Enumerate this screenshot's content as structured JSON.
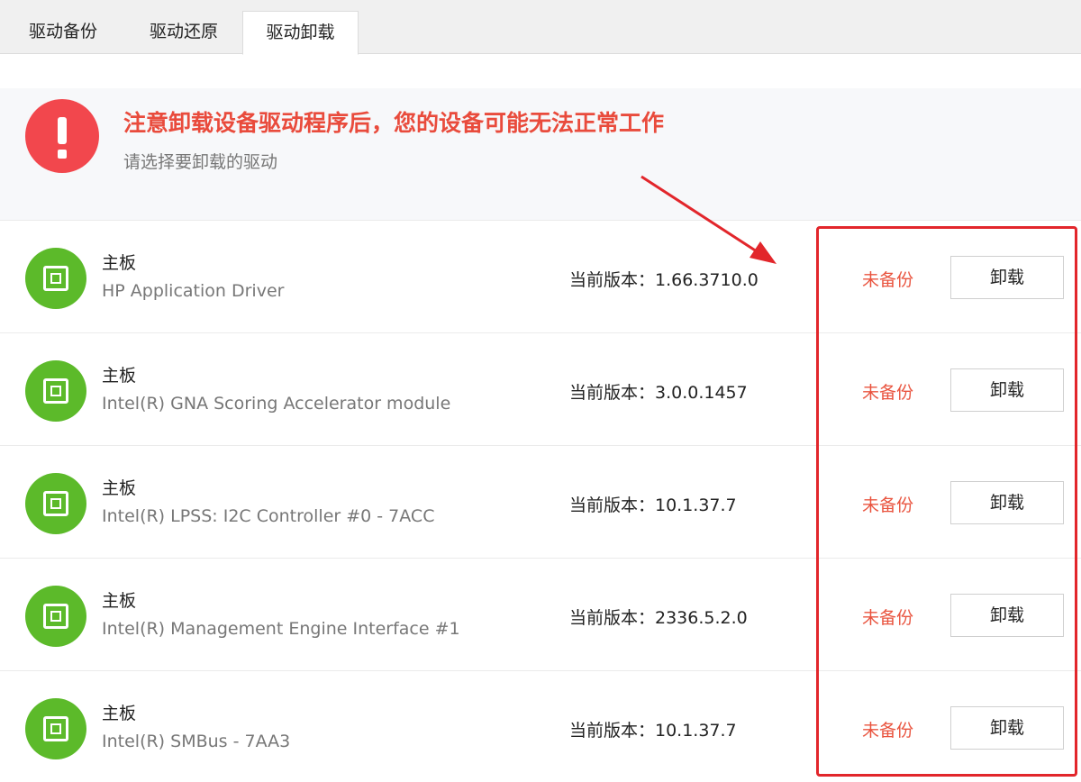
{
  "tabs": [
    {
      "label": "驱动备份",
      "active": false
    },
    {
      "label": "驱动还原",
      "active": false
    },
    {
      "label": "驱动卸载",
      "active": true
    }
  ],
  "notice": {
    "icon": "warning-exclamation-icon",
    "title": "注意卸载设备驱动程序后，您的设备可能无法正常工作",
    "subtitle": "请选择要卸载的驱动"
  },
  "drivers": [
    {
      "category": "主板",
      "name": "HP Application Driver",
      "version": "当前版本：1.66.3710.0",
      "status": "未备份",
      "action": "卸载"
    },
    {
      "category": "主板",
      "name": "Intel(R) GNA Scoring Accelerator module",
      "version": "当前版本：3.0.0.1457",
      "status": "未备份",
      "action": "卸载"
    },
    {
      "category": "主板",
      "name": "Intel(R) LPSS: I2C Controller #0 - 7ACC",
      "version": "当前版本：10.1.37.7",
      "status": "未备份",
      "action": "卸载"
    },
    {
      "category": "主板",
      "name": "Intel(R) Management Engine Interface #1",
      "version": "当前版本：2336.5.2.0",
      "status": "未备份",
      "action": "卸载"
    },
    {
      "category": "主板",
      "name": "Intel(R) SMBus - 7AA3",
      "version": "当前版本：10.1.37.7",
      "status": "未备份",
      "action": "卸载"
    }
  ],
  "colors": {
    "warning_red": "#e94b3c",
    "status_red": "#e9543f",
    "device_green": "#5cba2a",
    "annotation_red": "#e2262b"
  },
  "annotation": {
    "type": "red-box-and-arrow",
    "target": "status-and-uninstall-column"
  }
}
